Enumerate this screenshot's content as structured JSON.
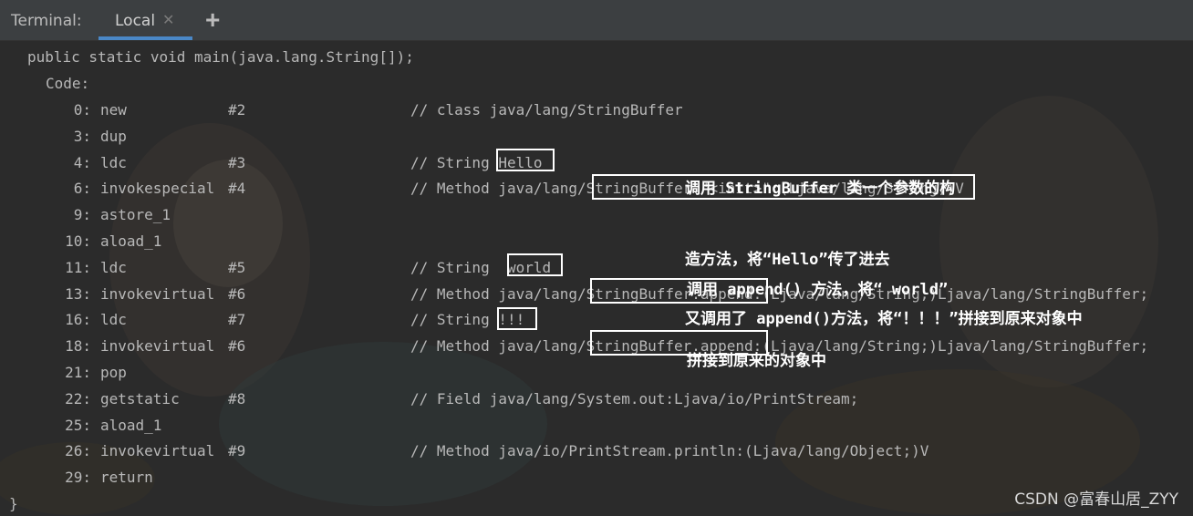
{
  "tabbar": {
    "title": "Terminal:",
    "tab_local": "Local",
    "close_icon": "close-icon",
    "add_icon": "plus-icon"
  },
  "code": {
    "signature": "public static void main(java.lang.String[]);",
    "code_label": "Code:",
    "closing": "}",
    "lines": [
      {
        "off": "0:",
        "op": "new",
        "ref": "#2",
        "comment": "// class java/lang/StringBuffer"
      },
      {
        "off": "3:",
        "op": "dup",
        "ref": "",
        "comment": ""
      },
      {
        "off": "4:",
        "op": "ldc",
        "ref": "#3",
        "comment": "// String Hello"
      },
      {
        "off": "6:",
        "op": "invokespecial",
        "ref": "#4",
        "comment": "// Method java/lang/StringBuffer.\"<init>\":(Ljava/lang/String;)V"
      },
      {
        "off": "9:",
        "op": "astore_1",
        "ref": "",
        "comment": ""
      },
      {
        "off": "10:",
        "op": "aload_1",
        "ref": "",
        "comment": ""
      },
      {
        "off": "11:",
        "op": "ldc",
        "ref": "#5",
        "comment": "// String  world"
      },
      {
        "off": "13:",
        "op": "invokevirtual",
        "ref": "#6",
        "comment": "// Method java/lang/StringBuffer.append:(Ljava/lang/String;)Ljava/lang/StringBuffer;"
      },
      {
        "off": "16:",
        "op": "ldc",
        "ref": "#7",
        "comment": "// String !!!"
      },
      {
        "off": "18:",
        "op": "invokevirtual",
        "ref": "#6",
        "comment": "// Method java/lang/StringBuffer.append:(Ljava/lang/String;)Ljava/lang/StringBuffer;"
      },
      {
        "off": "21:",
        "op": "pop",
        "ref": "",
        "comment": ""
      },
      {
        "off": "22:",
        "op": "getstatic",
        "ref": "#8",
        "comment": "// Field java/lang/System.out:Ljava/io/PrintStream;"
      },
      {
        "off": "25:",
        "op": "aload_1",
        "ref": "",
        "comment": ""
      },
      {
        "off": "26:",
        "op": "invokevirtual",
        "ref": "#9",
        "comment": "// Method java/io/PrintStream.println:(Ljava/lang/Object;)V"
      },
      {
        "off": "29:",
        "op": "return",
        "ref": "",
        "comment": ""
      }
    ]
  },
  "annotations": {
    "a1_line1": "调用 StringBuffer 类一个参数的构",
    "a1_line2": "造方法，将“Hello”传了进去",
    "a2_line1": "调用 append() 方法，将“ world”",
    "a2_line2": "拼接到原来的对象中",
    "a3": "又调用了 append()方法，将“！！！”拼接到原来对象中"
  },
  "watermark": "CSDN @富春山居_ZYY",
  "colors": {
    "background": "#2b2b2b",
    "tabbar": "#3c3f41",
    "accent": "#4a88c7",
    "code_text": "#b8b8b8",
    "highlight_box": "#ffffff"
  }
}
